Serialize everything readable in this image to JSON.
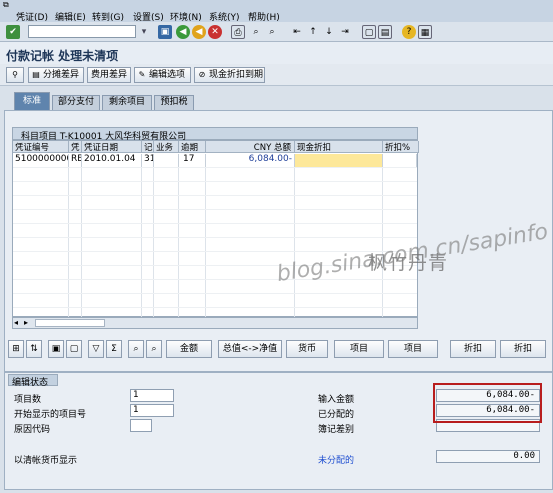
{
  "menu": [
    "凭证(D)",
    "编辑(E)",
    "转到(G)",
    "设置(S)",
    "环境(N)",
    "系统(Y)",
    "帮助(H)"
  ],
  "page_title": "付款记帐 处理未清项",
  "app_buttons": [
    "分摊差异",
    "费用差异",
    "编辑选项",
    "现金折扣到期"
  ],
  "tabs": [
    "标准",
    "部分支付",
    "剩余项目",
    "预扣税"
  ],
  "active_tab": "标准",
  "grid": {
    "caption": "科目项目 T-K10001 大风华科贸有限公司",
    "headers": [
      "凭证编号",
      "凭",
      "凭证日期",
      "记",
      "业务",
      "逾期",
      "CNY 总额",
      "现金折扣",
      "折扣%"
    ],
    "row": [
      "5100000000",
      "RE",
      "2010.01.04",
      "31",
      "",
      "17",
      "6,084.00-",
      "",
      ""
    ]
  },
  "action_buttons": [
    "金额",
    "总值<->净值",
    "货币",
    "项目",
    "项目",
    "折扣",
    "折扣"
  ],
  "status": {
    "caption": "编辑状态",
    "item_count_label": "项目数",
    "item_count": "1",
    "first_item_label": "开始显示的项目号",
    "first_item": "1",
    "reason_code_label": "原因代码",
    "reason_code": "",
    "display_currency_label": "以清帐货币显示",
    "entered_amount_label": "输入金额",
    "entered_amount": "6,084.00-",
    "assigned_label": "已分配的",
    "assigned": "6,084.00-",
    "difference_label": "簿记差别",
    "difference": "",
    "unassigned_label": "未分配的",
    "unassigned": "0.00"
  },
  "watermark": {
    "line1": "枫竹丹青",
    "line2": "blog.sina.com.cn/sapinfo"
  },
  "colors": {
    "highlight_cell": "#fde89a",
    "red_box": "#b81d1d",
    "active_tab": "#5f84ad",
    "unassigned_label": "#1f4fd0"
  }
}
